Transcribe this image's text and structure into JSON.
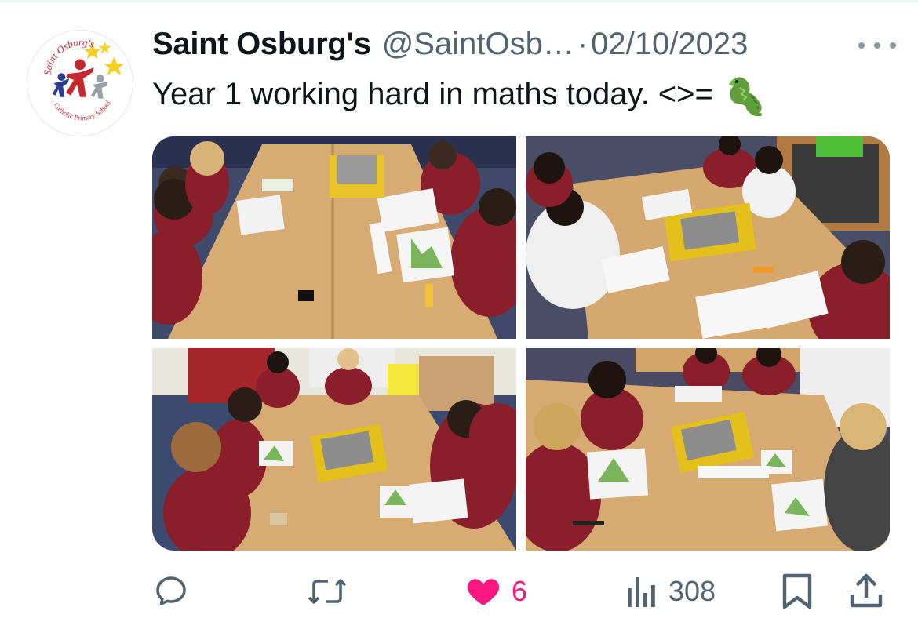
{
  "tweet": {
    "display_name": "Saint Osburg's",
    "handle": "@SaintOsb…",
    "separator": "·",
    "date": "02/10/2023",
    "text": "Year 1 working hard in maths today. <>=",
    "emoji": "crocodile-emoji"
  },
  "avatar": {
    "school_name": "Saint Osburg's",
    "school_subtitle": "Catholic Primary School"
  },
  "media": {
    "count": 4,
    "photos": [
      "classroom-photo-1",
      "classroom-photo-2",
      "classroom-photo-3",
      "classroom-photo-4"
    ]
  },
  "actions": {
    "reply": {
      "icon": "reply-icon",
      "count": ""
    },
    "retweet": {
      "icon": "retweet-icon",
      "count": ""
    },
    "like": {
      "icon": "heart-icon",
      "count": "6",
      "liked": true,
      "color": "#f91880"
    },
    "views": {
      "icon": "views-icon",
      "count": "308"
    },
    "bookmark": {
      "icon": "bookmark-icon"
    },
    "share": {
      "icon": "share-icon"
    }
  },
  "colors": {
    "text_primary": "#0f1419",
    "text_secondary": "#536471",
    "like_pink": "#f91880",
    "icon_gray": "#536471"
  }
}
